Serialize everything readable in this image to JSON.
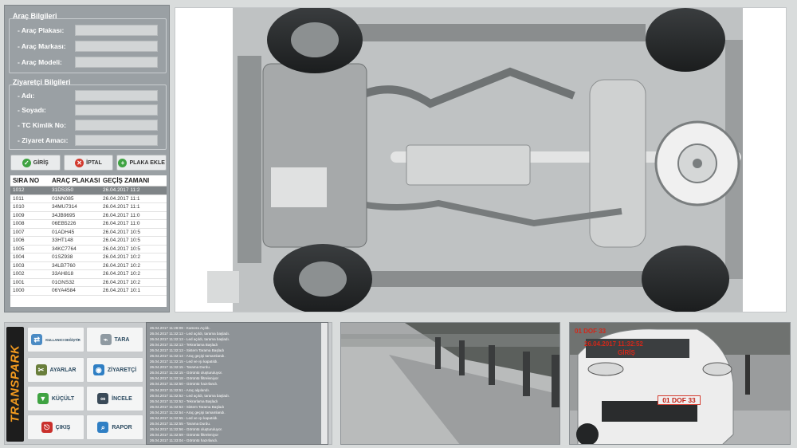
{
  "vehicle": {
    "title": "Araç Bilgileri",
    "fields": [
      {
        "label": "- Araç Plakası:",
        "value": ""
      },
      {
        "label": "- Araç Markası:",
        "value": ""
      },
      {
        "label": "- Araç Modeli:",
        "value": ""
      }
    ]
  },
  "visitor": {
    "title": "Ziyaretçi Bilgileri",
    "fields": [
      {
        "label": "- Adı:",
        "value": ""
      },
      {
        "label": "- Soyadı:",
        "value": ""
      },
      {
        "label": "- TC Kimlik No:",
        "value": ""
      },
      {
        "label": "- Ziyaret Amacı:",
        "value": ""
      }
    ]
  },
  "actions": {
    "entry": "GİRİŞ",
    "cancel": "İPTAL",
    "add_plate": "PLAKA EKLE"
  },
  "table": {
    "headers": [
      "SIRA NO",
      "ARAÇ PLAKASI",
      "GEÇİŞ ZAMANI"
    ],
    "rows": [
      [
        "1012",
        "31DS350",
        "26.04.2017 11:2"
      ],
      [
        "1011",
        "01NN085",
        "26.04.2017 11:1"
      ],
      [
        "1010",
        "34MU7314",
        "26.04.2017 11:1"
      ],
      [
        "1009",
        "34JB9695",
        "26.04.2017 11:0"
      ],
      [
        "1008",
        "06EB5226",
        "26.04.2017 11:0"
      ],
      [
        "1007",
        "01ADH45",
        "26.04.2017 10:5"
      ],
      [
        "1006",
        "33HT148",
        "26.04.2017 10:5"
      ],
      [
        "1005",
        "34KC7764",
        "26.04.2017 10:5"
      ],
      [
        "1004",
        "01SZ938",
        "26.04.2017 10:2"
      ],
      [
        "1003",
        "34LB7760",
        "26.04.2017 10:2"
      ],
      [
        "1002",
        "33AH818",
        "26.04.2017 10:2"
      ],
      [
        "1001",
        "01GNS32",
        "26.04.2017 10:2"
      ],
      [
        "1000",
        "06YA4584",
        "26.04.2017 10:1"
      ]
    ]
  },
  "logo": "TRANSPARK",
  "menu": {
    "change_user": "KULLANICI DEĞİŞTİR",
    "scan": "TARA",
    "settings": "AYARLAR",
    "visitor": "ZİYARETÇİ",
    "minimize": "KÜÇÜLT",
    "inspect": "İNCELE",
    "exit": "ÇIKIŞ",
    "report": "RAPOR"
  },
  "log": [
    "26.04.2017 11:28:09 - Kamera Açıldı.",
    "26.04.2017 11:32:13 - Led açıldı, tarama başladı.",
    "26.04.2017 11:32:13 - Led açıldı, tarama başladı.",
    "26.04.2017 11:32:13 - Tekrarlama Başladı",
    "26.04.2017 11:32:13 - Sistem Tarama Başladı",
    "26.04.2017 11:32:14 - Araç geçişi tamamlandı.",
    "26.04.2017 11:32:15 - Led ve ışı kapatıldı.",
    "26.04.2017 11:32:15 - Tarama Durdu.",
    "26.04.2017 11:32:15 - Görüntü oluşturuluyor.",
    "26.04.2017 11:32:18 - Görüntü filtreleniyor",
    "26.04.2017 11:32:50 - Görüntü hazırlandı.",
    "26.04.2017 11:32:51 - Araç algılandı.",
    "26.04.2017 11:32:52 - Led açıldı, tarama başladı.",
    "26.04.2017 11:32:52 - Tekrarlama Başladı",
    "26.04.2017 11:32:53 - Sistem Tarama Başladı",
    "26.04.2017 11:32:54 - Araç geçişi tamamlandı.",
    "26.04.2017 11:32:55 - Led ve ışı kapatıldı.",
    "26.04.2017 11:32:55 - Tarama Durdu.",
    "26.04.2017 11:32:56 - Görüntü oluşturuluyor.",
    "26.04.2017 11:32:59 - Görüntü filtreleniyor",
    "26.04.2017 11:33:04 - Görüntü hazırlandı."
  ],
  "plate_cam": {
    "plate": "01 DOF 33",
    "time": "26.04.2017 11:32:52",
    "status": "GİRİŞ"
  }
}
